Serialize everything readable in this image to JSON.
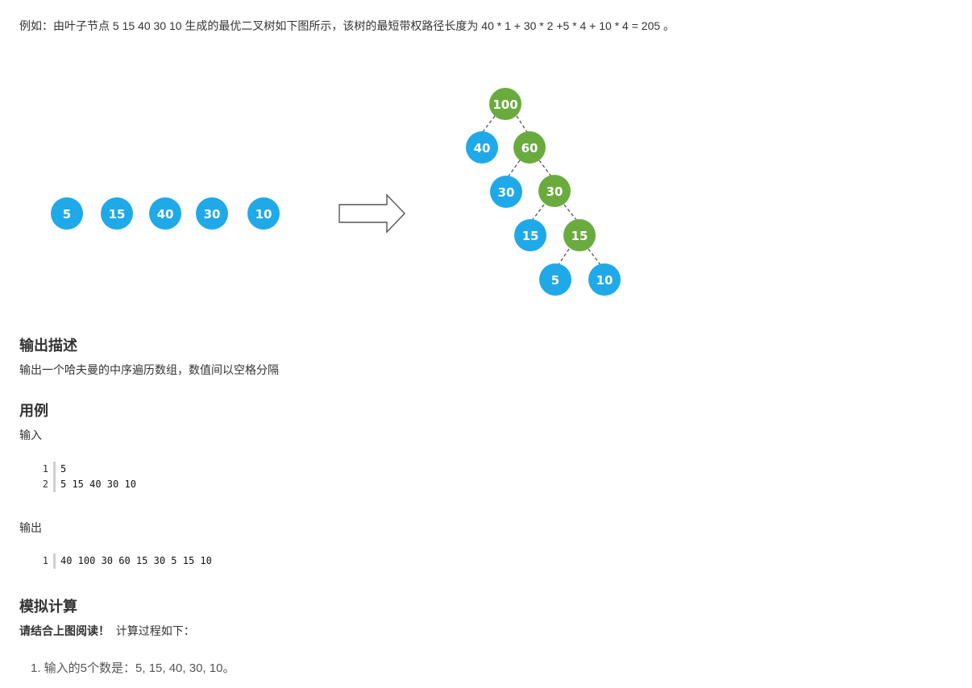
{
  "intro": "例如：由叶子节点 5 15 40 30 10 生成的最优二叉树如下图所示，该树的最短带权路径长度为 40 * 1 + 30 * 2 +5 * 4 + 10 * 4 = 205 。",
  "figure": {
    "leaves": [
      "5",
      "15",
      "40",
      "30",
      "10"
    ],
    "tree": {
      "root": "100",
      "level1": [
        "40",
        "60"
      ],
      "level2": [
        "30",
        "30"
      ],
      "level3": [
        "15",
        "15"
      ],
      "level4": [
        "5",
        "10"
      ]
    },
    "colors": {
      "leaf": "#1fa9e8",
      "internal": "#6aab3e"
    },
    "arrow_icon": "right-arrow-icon"
  },
  "output_section": {
    "heading": "输出描述",
    "text": "输出一个哈夫曼的中序遍历数组，数值间以空格分隔"
  },
  "example_section": {
    "heading": "用例",
    "input_label": "输入",
    "input_lines": [
      {
        "num": "1",
        "code": "5"
      },
      {
        "num": "2",
        "code": "5 15 40 30 10"
      }
    ],
    "output_label": "输出",
    "output_lines": [
      {
        "num": "1",
        "code": "40 100 30 60 15 30 5 15 10"
      }
    ]
  },
  "simulation_section": {
    "heading": "模拟计算",
    "note_bold": "请结合上图阅读！",
    "note_text": "计算过程如下：",
    "list": [
      "1. 输入的5个数是：5, 15, 40, 30, 10。"
    ]
  }
}
